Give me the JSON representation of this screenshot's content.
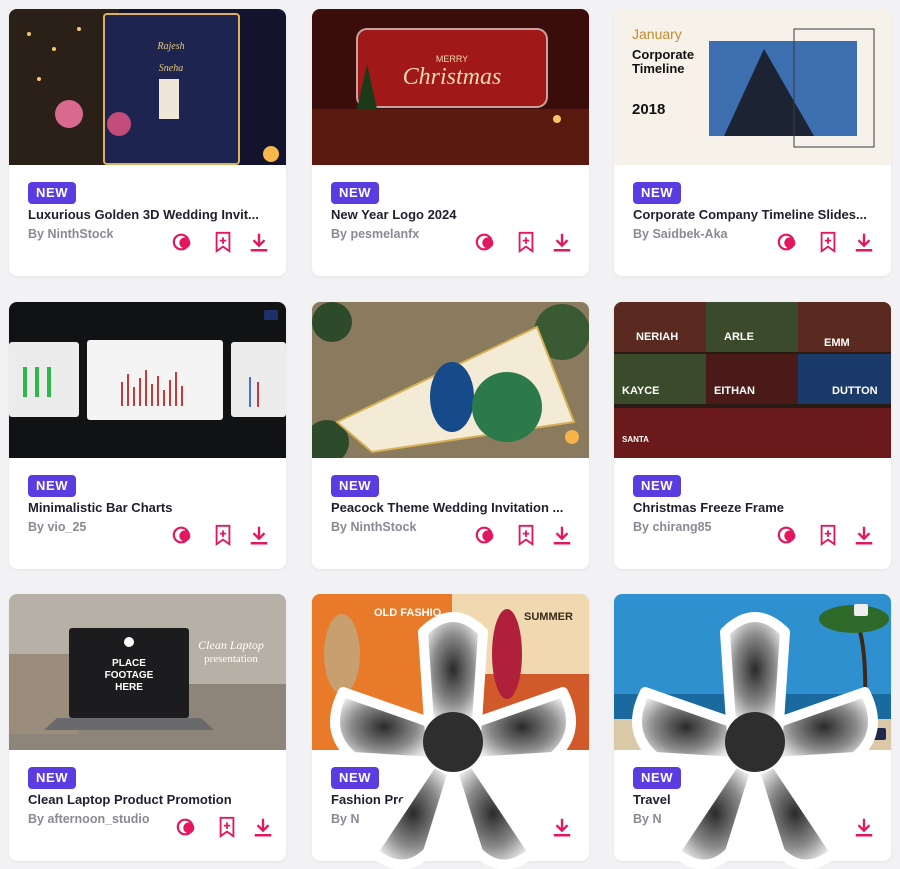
{
  "accent_color": "#e2175f",
  "badge_color": "#5b3ce0",
  "cards": [
    {
      "badge": "NEW",
      "title": "Luxurious Golden 3D Wedding Invit...",
      "author": "By NinthStock"
    },
    {
      "badge": "NEW",
      "title": "New Year Logo 2024",
      "author": "By pesmelanfx",
      "thumb_text": {
        "line1": "MERRY",
        "line2": "Christmas"
      }
    },
    {
      "badge": "NEW",
      "title": "Corporate Company Timeline Slides...",
      "author": "By Saidbek-Aka",
      "thumb_text": {
        "month": "January",
        "heading1": "Corporate",
        "heading2": "Timeline",
        "year": "2018"
      }
    },
    {
      "badge": "NEW",
      "title": "Minimalistic Bar Charts",
      "author": "By vio_25"
    },
    {
      "badge": "NEW",
      "title": "Peacock Theme Wedding Invitation ...",
      "author": "By NinthStock"
    },
    {
      "badge": "NEW",
      "title": "Christmas Freeze Frame",
      "author": "By chirang85",
      "thumb_text": {
        "names": [
          "NERIAH",
          "ARLE",
          "EMM",
          "KAYCE",
          "EITHAN",
          "DUTTON",
          "SANTA"
        ]
      }
    },
    {
      "badge": "NEW",
      "title": "Clean Laptop Product Promotion",
      "author": "By afternoon_studio",
      "thumb_text": {
        "screen1": "PLACE",
        "screen2": "FOOTAGE",
        "screen3": "HERE",
        "side1": "Clean Laptop",
        "side2": "presentation"
      }
    },
    {
      "badge": "NEW",
      "title": "Fashion Promo",
      "author": "By N",
      "thumb_text": {
        "left": "OLD FASHIO",
        "right": "SUMMER"
      }
    },
    {
      "badge": "NEW",
      "title": "Travel",
      "author": "By N"
    }
  ],
  "icons": {
    "preview": "preview-icon",
    "save": "bookmark-add-icon",
    "download": "download-icon",
    "overlay": "asterisk-overlay-icon"
  }
}
